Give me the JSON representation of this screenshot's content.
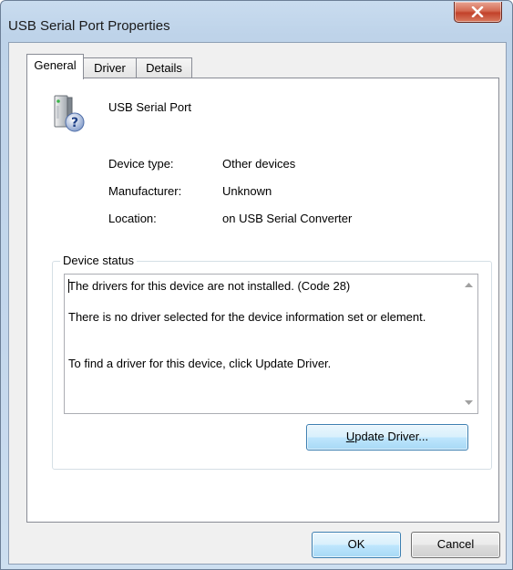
{
  "window": {
    "title": "USB Serial Port Properties"
  },
  "tabs": [
    {
      "label": "General",
      "active": true
    },
    {
      "label": "Driver",
      "active": false
    },
    {
      "label": "Details",
      "active": false
    }
  ],
  "device": {
    "icon": "usb-device-unknown-icon",
    "name": "USB Serial Port"
  },
  "properties": [
    {
      "label": "Device type:",
      "value": "Other devices"
    },
    {
      "label": "Manufacturer:",
      "value": "Unknown"
    },
    {
      "label": "Location:",
      "value": "on USB Serial Converter"
    }
  ],
  "status": {
    "group_label": "Device status",
    "text": "The drivers for this device are not installed. (Code 28)\n\nThere is no driver selected for the device information set or element.\n\n\nTo find a driver for this device, click Update Driver."
  },
  "buttons": {
    "update_driver_mnemonic": "U",
    "update_driver_rest": "pdate Driver...",
    "ok": "OK",
    "cancel": "Cancel"
  },
  "colors": {
    "frame": "#c4d7ec",
    "close_button": "#c2412a",
    "default_button_border": "#3c7fb1"
  }
}
